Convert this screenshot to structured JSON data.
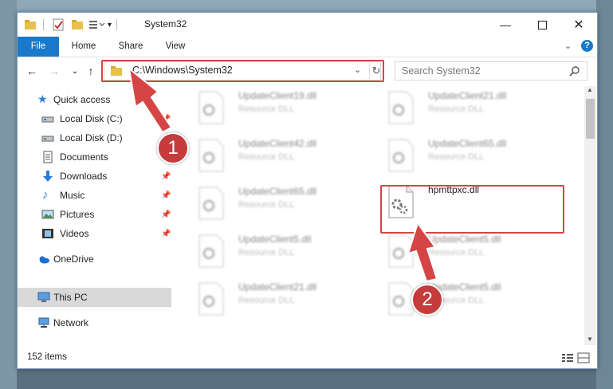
{
  "window": {
    "title": "System32"
  },
  "ribbon": {
    "tabs": [
      "File",
      "Home",
      "Share",
      "View"
    ]
  },
  "nav": {
    "address": "C:\\Windows\\System32",
    "search_placeholder": "Search System32"
  },
  "sidebar": {
    "items": [
      {
        "label": "Quick access",
        "icon": "star-icon"
      },
      {
        "label": "Local Disk (C:)",
        "icon": "drive-icon"
      },
      {
        "label": "Local Disk (D:)",
        "icon": "drive-icon"
      },
      {
        "label": "Documents",
        "icon": "documents-icon"
      },
      {
        "label": "Downloads",
        "icon": "download-icon"
      },
      {
        "label": "Music",
        "icon": "music-icon"
      },
      {
        "label": "Pictures",
        "icon": "pictures-icon"
      },
      {
        "label": "Videos",
        "icon": "videos-icon"
      },
      {
        "label": "OneDrive",
        "icon": "cloud-icon"
      },
      {
        "label": "This PC",
        "icon": "computer-icon"
      },
      {
        "label": "Network",
        "icon": "network-icon"
      }
    ]
  },
  "files": [
    {
      "name": "UpdateClient19.dll",
      "type": "Resource DLL"
    },
    {
      "name": "UpdateClient21.dll",
      "type": "Resource DLL"
    },
    {
      "name": "UpdateClient42.dll",
      "type": "Resource DLL"
    },
    {
      "name": "UpdateClient65.dll",
      "type": "Resource DLL"
    },
    {
      "name": "UpdateClient65.dll",
      "type": "Resource DLL"
    },
    {
      "name": "hpmttpxc.dll",
      "type": ""
    },
    {
      "name": "UpdateClient5.dll",
      "type": "Resource DLL"
    },
    {
      "name": "UpdateClient5.dll",
      "type": "Resource DLL"
    },
    {
      "name": "UpdateClient21.dll",
      "type": "Resource DLL"
    },
    {
      "name": "UpdateClient5.dll",
      "type": "Resource DLL"
    }
  ],
  "status": {
    "items": "152 items"
  },
  "annotations": {
    "step1": "1",
    "step2": "2",
    "color": "#d64545"
  }
}
